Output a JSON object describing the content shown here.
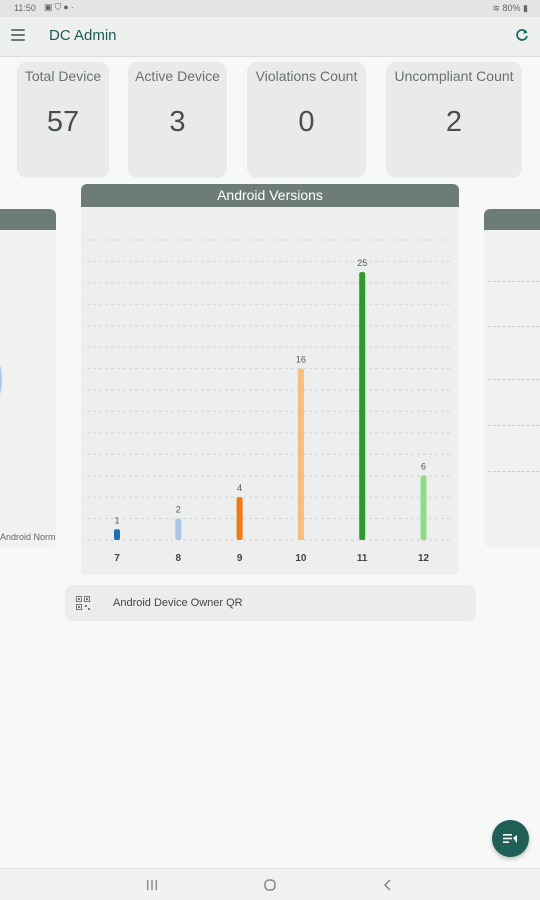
{
  "status_bar": {
    "time": "11:50",
    "icons": [
      "gallery-icon",
      "shield-icon",
      "notification-icon",
      "dot-icon"
    ],
    "battery": "80%"
  },
  "app_bar": {
    "title": "DC Admin",
    "menu_icon": "hamburger-menu-icon",
    "refresh_icon": "refresh-icon"
  },
  "stats": [
    {
      "label": "Total Device",
      "value": "57"
    },
    {
      "label": "Active Device",
      "value": "3"
    },
    {
      "label": "Violations Count",
      "value": "0"
    },
    {
      "label": "Uncompliant Count",
      "value": "2"
    }
  ],
  "side_cards": {
    "left_legend": "Android Norm",
    "left_pie_colors": [
      "#b3c9ec",
      "#f08a24"
    ]
  },
  "chart_data": {
    "type": "bar",
    "title": "Android Versions",
    "categories": [
      "7",
      "8",
      "9",
      "10",
      "11",
      "12"
    ],
    "values": [
      1,
      2,
      4,
      16,
      25,
      6
    ],
    "colors": [
      "#1f6fb4",
      "#a9c3e6",
      "#f07b12",
      "#f9bd7f",
      "#2e9a2e",
      "#8fdc84"
    ],
    "ylim": [
      0,
      28
    ],
    "grid": true,
    "xlabel": "",
    "ylabel": ""
  },
  "qr_row": {
    "icon": "qr-code-icon",
    "label": "Android Device Owner QR"
  },
  "fab": {
    "icon": "notes-icon"
  },
  "nav_bar": {
    "recents_icon": "recents-icon",
    "home_icon": "home-icon",
    "back_icon": "back-icon"
  }
}
